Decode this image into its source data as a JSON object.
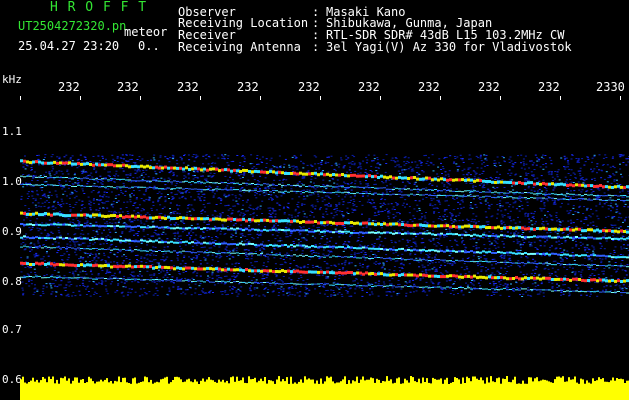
{
  "header": {
    "title": "H R O F F T",
    "file_name": "UT2504272320.pn",
    "file_type": "meteor",
    "date_time": "25.04.27 23:20",
    "count": "0.."
  },
  "info_rows": [
    {
      "label": "Observer",
      "value": "Masaki Kano"
    },
    {
      "label": "Receiving Location",
      "value": "Shibukawa, Gunma, Japan"
    },
    {
      "label": "Receiver",
      "value": "RTL-SDR SDR# 43dB L15 103.2MHz CW"
    },
    {
      "label": "Receiving Antenna",
      "value": "3el Yagi(V) Az 330 for Vladivostok"
    }
  ],
  "axis": {
    "y_unit": "kHz",
    "y_ticks": [
      "1.1",
      "1.0",
      "0.9",
      "0.8",
      "0.7",
      "0.6"
    ],
    "x_ticks": [
      "232",
      "232",
      "232",
      "232",
      "232",
      "232",
      "232",
      "232",
      "232",
      "232",
      "2330"
    ]
  },
  "colors": {
    "background": "#000000",
    "title": "#33e633",
    "text": "#ffffff",
    "noise_floor": "#1a2bff",
    "trace_hot": "#ff3030",
    "trace_mid": "#e8e800",
    "amplitude": "#ffff00"
  }
}
